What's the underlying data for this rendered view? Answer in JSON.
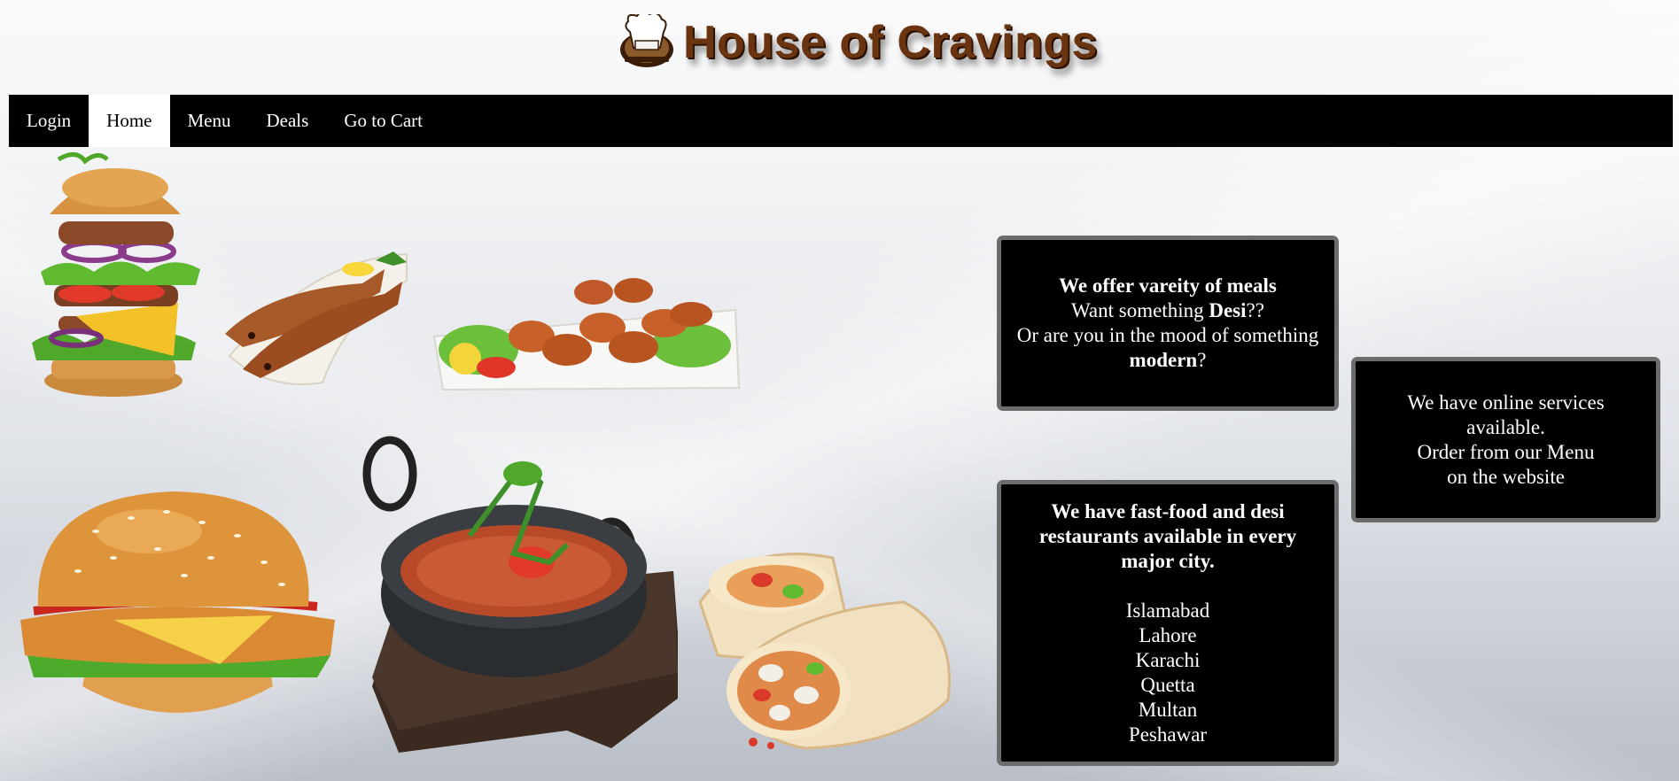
{
  "site": {
    "title": "House of Cravings"
  },
  "nav": {
    "items": [
      {
        "label": "Login",
        "active": false
      },
      {
        "label": "Home",
        "active": true
      },
      {
        "label": "Menu",
        "active": false
      },
      {
        "label": "Deals",
        "active": false
      },
      {
        "label": "Go to Cart",
        "active": false
      }
    ]
  },
  "boxes": {
    "meals": {
      "heading": "We offer vareity of meals",
      "line2_prefix": "Want something ",
      "line2_bold": "Desi",
      "line2_suffix": "??",
      "line3": "Or are you in the mood of something",
      "line4_bold": "modern",
      "line4_suffix": "?"
    },
    "cities": {
      "heading": "We have fast-food and desi restaurants available in every major city.",
      "list": [
        "Islamabad",
        "Lahore",
        "Karachi",
        "Quetta",
        "Multan",
        "Peshawar"
      ]
    },
    "online": {
      "line1": "We have online services available.",
      "line2": "Order from our Menu",
      "line3": "on the website"
    }
  },
  "icons": {
    "logo": "chef-hat-icon",
    "foods": [
      "stacked-burger",
      "fried-fish-plate",
      "chicken-wings-plate",
      "chicken-burger",
      "karahi-curry",
      "chicken-wrap"
    ]
  },
  "colors": {
    "nav_bg": "#000000",
    "nav_active_bg": "#ffffff",
    "title_brown": "#6b3410",
    "box_bg": "#000000",
    "box_border": "#6c6c6c"
  }
}
